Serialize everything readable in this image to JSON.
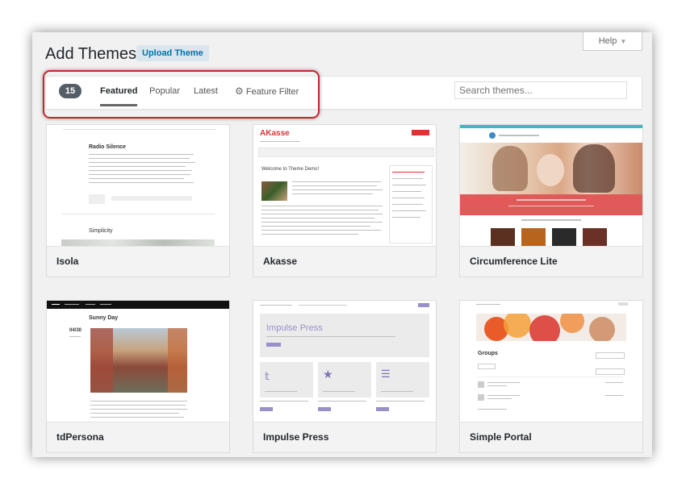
{
  "page": {
    "title": "Add Themes",
    "upload_label": "Upload Theme",
    "help_label": "Help"
  },
  "filter": {
    "count": "15",
    "tabs": [
      "Featured",
      "Popular",
      "Latest"
    ],
    "feature_filter_label": "Feature Filter",
    "search_placeholder": "Search themes..."
  },
  "colors": {
    "highlight": "#c9252c",
    "accent": "#0073aa"
  },
  "themes": [
    {
      "name": "Isola",
      "shot_title": "Radio Silence",
      "shot_subtitle": "Simplicity"
    },
    {
      "name": "Akasse",
      "shot_logo": "AKasse",
      "shot_heading": "Welcome to Theme Demo!"
    },
    {
      "name": "Circumference Lite"
    },
    {
      "name": "tdPersona",
      "shot_heading": "Sunny Day",
      "shot_date": "04/30"
    },
    {
      "name": "Impulse Press",
      "shot_hero": "Impulse Press"
    },
    {
      "name": "Simple Portal",
      "shot_heading": "Groups"
    }
  ]
}
